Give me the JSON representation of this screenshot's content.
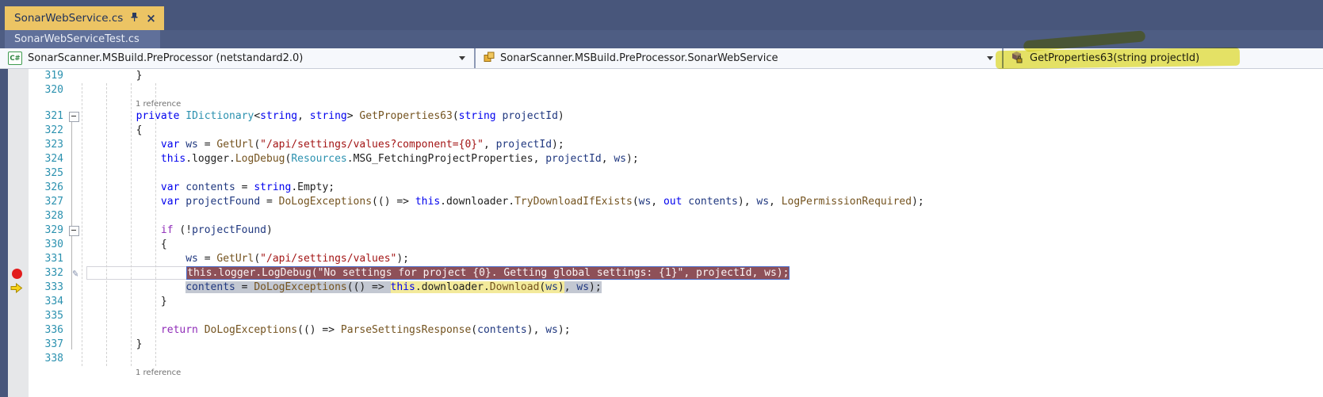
{
  "window": {
    "app": "Visual Studio code editor"
  },
  "tabs": {
    "active": {
      "label": "SonarWebService.cs",
      "icons": [
        "pin-icon",
        "close-icon"
      ]
    },
    "background": {
      "label": "SonarWebServiceTest.cs"
    }
  },
  "navbar": {
    "project": {
      "label": "SonarScanner.MSBuild.PreProcessor (netstandard2.0)",
      "icon": "csharp-project-icon"
    },
    "type": {
      "label": "SonarScanner.MSBuild.PreProcessor.SonarWebService",
      "icon": "class-icon"
    },
    "member": {
      "label": "GetProperties63(string projectId)",
      "icon": "method-private-icon",
      "annotated": true
    }
  },
  "annotation": {
    "tool": "yellow-highlighter",
    "color": "#e1d800",
    "target": "GetProperties63(string projectId)"
  },
  "colors": {
    "tab_active_bg": "#ecc464",
    "tab_bar_bg": "#48567b",
    "tab_bg_tab": "#60709a",
    "breakpoint_red": "#e21d1d",
    "current_statement_yellow": "#f3ea9b",
    "breakpoint_line_bg": "#8e5058",
    "selection_gray": "#c3c8d2",
    "line_number": "#2b91af",
    "keyword": "#0000ee",
    "control_keyword": "#8f2bb8",
    "type": "#2b91af",
    "method": "#74531f",
    "string": "#a31515",
    "local": "#1f377f"
  },
  "editor": {
    "codelens_label": "1 reference",
    "lines": [
      {
        "n": "319",
        "t": [
          [
            "        }"
          ]
        ]
      },
      {
        "n": "320",
        "t": [
          [
            ""
          ]
        ]
      },
      {
        "cl": "1 reference"
      },
      {
        "n": "321",
        "fold": "-",
        "t": [
          [
            "        "
          ],
          [
            "private",
            "kw"
          ],
          [
            " "
          ],
          [
            "IDictionary",
            "ty"
          ],
          [
            "<"
          ],
          [
            "string",
            "kw"
          ],
          [
            ", "
          ],
          [
            "string",
            "kw"
          ],
          [
            "> "
          ],
          [
            "GetProperties63",
            "me"
          ],
          [
            "("
          ],
          [
            "string",
            "kw"
          ],
          [
            " "
          ],
          [
            "projectId",
            "lo"
          ],
          [
            ")"
          ]
        ]
      },
      {
        "n": "322",
        "fl": 1,
        "t": [
          [
            "        {"
          ]
        ]
      },
      {
        "n": "323",
        "fl": 1,
        "t": [
          [
            "            "
          ],
          [
            "var",
            "kw"
          ],
          [
            " "
          ],
          [
            "ws",
            "lo"
          ],
          [
            " = "
          ],
          [
            "GetUrl",
            "me"
          ],
          [
            "("
          ],
          [
            "\"/api/settings/values?component={0}\"",
            "st"
          ],
          [
            ", "
          ],
          [
            "projectId",
            "lo"
          ],
          [
            ");"
          ]
        ]
      },
      {
        "n": "324",
        "fl": 1,
        "t": [
          [
            "            "
          ],
          [
            "this",
            "kw"
          ],
          [
            "."
          ],
          [
            "logger"
          ],
          [
            "."
          ],
          [
            "LogDebug",
            "me"
          ],
          [
            "("
          ],
          [
            "Resources",
            "ty"
          ],
          [
            "."
          ],
          [
            "MSG_FetchingProjectProperties"
          ],
          [
            ", "
          ],
          [
            "projectId",
            "lo"
          ],
          [
            ", "
          ],
          [
            "ws",
            "lo"
          ],
          [
            ");"
          ]
        ]
      },
      {
        "n": "325",
        "fl": 1,
        "t": [
          [
            ""
          ]
        ]
      },
      {
        "n": "326",
        "fl": 1,
        "t": [
          [
            "            "
          ],
          [
            "var",
            "kw"
          ],
          [
            " "
          ],
          [
            "contents",
            "lo"
          ],
          [
            " = "
          ],
          [
            "string",
            "kw"
          ],
          [
            "."
          ],
          [
            "Empty"
          ],
          [
            ";"
          ]
        ]
      },
      {
        "n": "327",
        "fl": 1,
        "t": [
          [
            "            "
          ],
          [
            "var",
            "kw"
          ],
          [
            " "
          ],
          [
            "projectFound",
            "lo"
          ],
          [
            " = "
          ],
          [
            "DoLogExceptions",
            "me"
          ],
          [
            "(() => "
          ],
          [
            "this",
            "kw"
          ],
          [
            "."
          ],
          [
            "downloader"
          ],
          [
            "."
          ],
          [
            "TryDownloadIfExists",
            "me"
          ],
          [
            "("
          ],
          [
            "ws",
            "lo"
          ],
          [
            ", "
          ],
          [
            "out",
            "kw"
          ],
          [
            " "
          ],
          [
            "contents",
            "lo"
          ],
          [
            "), "
          ],
          [
            "ws",
            "lo"
          ],
          [
            ", "
          ],
          [
            "LogPermissionRequired",
            "me"
          ],
          [
            ");"
          ]
        ]
      },
      {
        "n": "328",
        "fl": 1,
        "t": [
          [
            ""
          ]
        ]
      },
      {
        "n": "329",
        "fold": "-",
        "t": [
          [
            "            "
          ],
          [
            "if",
            "ct"
          ],
          [
            " (!"
          ],
          [
            "projectFound",
            "lo"
          ],
          [
            ")"
          ]
        ]
      },
      {
        "n": "330",
        "fl": 1,
        "t": [
          [
            "            {"
          ]
        ]
      },
      {
        "n": "331",
        "fl": 1,
        "t": [
          [
            "                "
          ],
          [
            "ws",
            "lo"
          ],
          [
            " = "
          ],
          [
            "GetUrl",
            "me"
          ],
          [
            "("
          ],
          [
            "\"/api/settings/values\"",
            "st"
          ],
          [
            ");"
          ]
        ]
      },
      {
        "n": "332",
        "fl": 1,
        "bpt": 1,
        "pencil": 1,
        "wrap": "bp",
        "lead": "                ",
        "t": [
          [
            "this.logger.LogDebug(\"No settings for project {0}. Getting global settings: {1}\", projectId, ws);",
            "bp"
          ]
        ]
      },
      {
        "n": "333",
        "fl": 1,
        "cur": 1,
        "t": [
          [
            "                "
          ],
          [
            "contents",
            "lo sg"
          ],
          [
            " = ",
            "pl sg"
          ],
          [
            "DoLogExceptions",
            "me sg"
          ],
          [
            "(() => ",
            "pl sg"
          ],
          [
            "this",
            "kw sy"
          ],
          [
            ".",
            "pl sy"
          ],
          [
            "downloader",
            "pl sy"
          ],
          [
            ".",
            "pl sy"
          ],
          [
            "Download",
            "me sy"
          ],
          [
            "(",
            "pl sy"
          ],
          [
            "ws",
            "lo sy"
          ],
          [
            ")",
            "pl sy"
          ],
          [
            ", ",
            "pl sg"
          ],
          [
            "ws",
            "lo sg"
          ],
          [
            ");",
            "pl sg"
          ]
        ]
      },
      {
        "n": "334",
        "fl": 1,
        "t": [
          [
            "            }"
          ]
        ]
      },
      {
        "n": "335",
        "fl": 1,
        "t": [
          [
            ""
          ]
        ]
      },
      {
        "n": "336",
        "fl": 1,
        "t": [
          [
            "            "
          ],
          [
            "return",
            "ct"
          ],
          [
            " "
          ],
          [
            "DoLogExceptions",
            "me"
          ],
          [
            "(() => "
          ],
          [
            "ParseSettingsResponse",
            "me"
          ],
          [
            "("
          ],
          [
            "contents",
            "lo"
          ],
          [
            "), "
          ],
          [
            "ws",
            "lo"
          ],
          [
            ");"
          ]
        ]
      },
      {
        "n": "337",
        "fl": 1,
        "t": [
          [
            "        }"
          ]
        ]
      },
      {
        "n": "338",
        "t": [
          [
            ""
          ]
        ]
      },
      {
        "cl": "1 reference"
      }
    ]
  }
}
